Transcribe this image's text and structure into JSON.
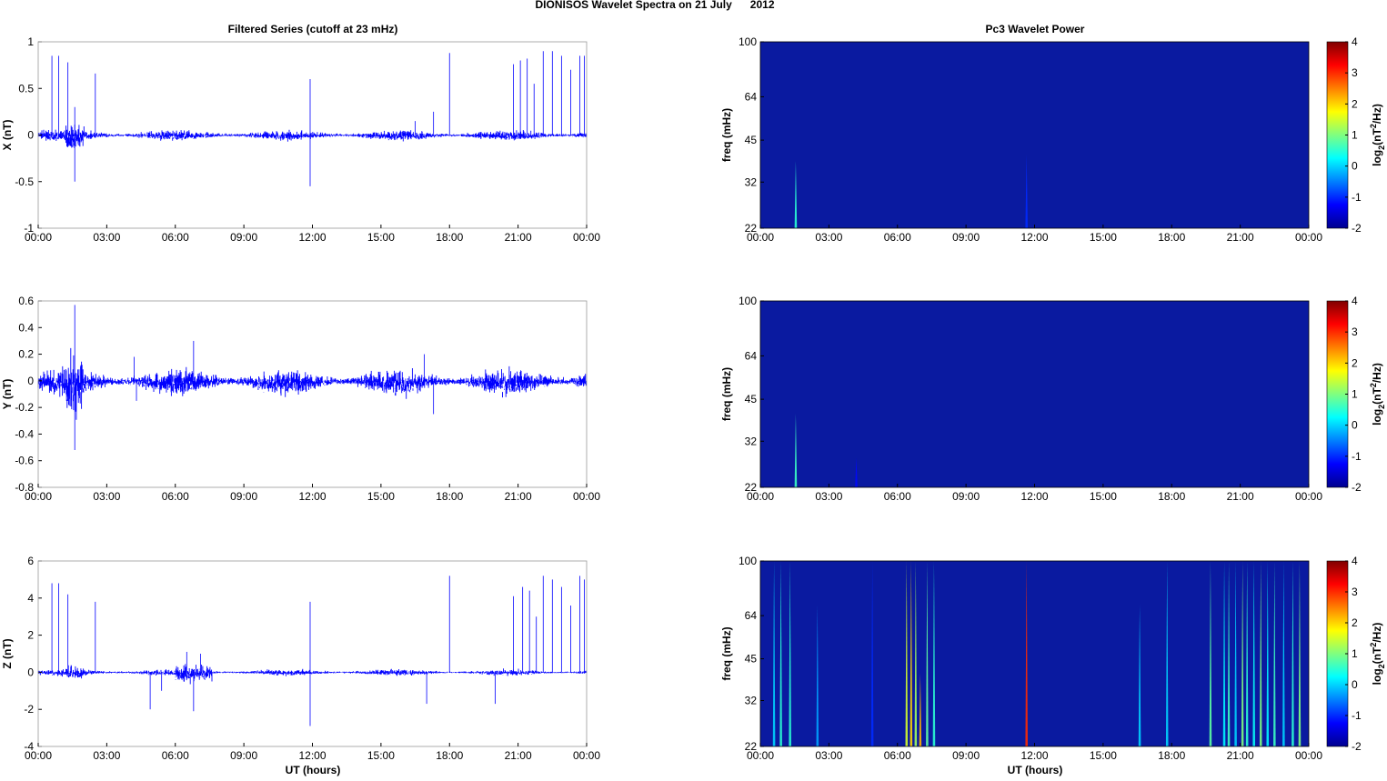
{
  "title": "DIONISOS Wavelet Spectra on 21 July      2012",
  "left_title": "Filtered Series (cutoff at 23 mHz)",
  "right_title": "Pc3 Wavelet Power",
  "xlabel": "UT (hours)",
  "x_ticks": [
    "00:00",
    "03:00",
    "06:00",
    "09:00",
    "12:00",
    "15:00",
    "18:00",
    "21:00",
    "00:00"
  ],
  "colors": {
    "series": "#0000ff",
    "background": "#0a1aa0",
    "axis": "#000000"
  },
  "chart_data": [
    {
      "type": "line",
      "ylabel": "X (nT)",
      "ylim": [
        -1,
        1
      ],
      "yticks": [
        -1,
        -0.5,
        0,
        0.5,
        1
      ],
      "xlim": [
        0,
        24
      ],
      "noise": 0.04,
      "spikes": [
        [
          0.6,
          0.85
        ],
        [
          0.9,
          0.85
        ],
        [
          1.3,
          0.78
        ],
        [
          1.6,
          0.3
        ],
        [
          1.6,
          -0.5
        ],
        [
          2.5,
          0.66
        ],
        [
          11.9,
          0.6
        ],
        [
          11.9,
          -0.55
        ],
        [
          16.5,
          0.15
        ],
        [
          18.0,
          0.88
        ],
        [
          17.3,
          0.25
        ],
        [
          20.8,
          0.76
        ],
        [
          21.1,
          0.8
        ],
        [
          21.4,
          0.82
        ],
        [
          21.7,
          0.55
        ],
        [
          22.1,
          0.9
        ],
        [
          22.5,
          0.9
        ],
        [
          22.9,
          0.85
        ],
        [
          23.3,
          0.7
        ],
        [
          23.7,
          0.85
        ],
        [
          23.9,
          0.85
        ]
      ]
    },
    {
      "type": "line",
      "ylabel": "Y (nT)",
      "ylim": [
        -0.8,
        0.6
      ],
      "yticks": [
        -0.8,
        -0.6,
        -0.4,
        -0.2,
        0,
        0.2,
        0.4,
        0.6
      ],
      "xlim": [
        0,
        24
      ],
      "noise": 0.07,
      "spikes": [
        [
          1.6,
          0.57
        ],
        [
          1.6,
          -0.52
        ],
        [
          4.2,
          0.18
        ],
        [
          4.3,
          -0.15
        ],
        [
          6.8,
          0.3
        ],
        [
          17.3,
          -0.25
        ],
        [
          16.9,
          0.2
        ]
      ]
    },
    {
      "type": "line",
      "ylabel": "Z (nT)",
      "ylim": [
        -4,
        6
      ],
      "yticks": [
        -4,
        -2,
        0,
        2,
        4,
        6
      ],
      "xlim": [
        0,
        24
      ],
      "noise": 0.12,
      "spikes": [
        [
          0.6,
          4.8
        ],
        [
          0.9,
          4.8
        ],
        [
          1.3,
          4.2
        ],
        [
          2.5,
          3.8
        ],
        [
          4.9,
          -2
        ],
        [
          5.4,
          -1.0
        ],
        [
          6.5,
          1.1
        ],
        [
          6.8,
          -2.1
        ],
        [
          7.1,
          1.0
        ],
        [
          11.9,
          3.8
        ],
        [
          11.9,
          -2.9
        ],
        [
          17.0,
          -1.7
        ],
        [
          18.0,
          5.2
        ],
        [
          20.0,
          -1.7
        ],
        [
          20.8,
          4.1
        ],
        [
          21.2,
          4.6
        ],
        [
          21.5,
          4.4
        ],
        [
          21.8,
          3.0
        ],
        [
          22.1,
          5.2
        ],
        [
          22.5,
          5.0
        ],
        [
          22.9,
          4.6
        ],
        [
          23.3,
          3.6
        ],
        [
          23.7,
          5.2
        ],
        [
          23.9,
          5.0
        ]
      ]
    },
    {
      "type": "heatmap",
      "ylabel": "freq (mHz)",
      "yticks": [
        22,
        32,
        45,
        64,
        100
      ],
      "ylim": [
        22,
        100
      ],
      "xlim": [
        0,
        24
      ],
      "clim": [
        -2,
        4
      ],
      "cbar_label": "log2(nT2/Hz)",
      "cticks": [
        -2,
        -1,
        0,
        1,
        2,
        3,
        4
      ],
      "streaks": [
        [
          1.55,
          0.5,
          38
        ],
        [
          11.65,
          -1,
          40
        ]
      ]
    },
    {
      "type": "heatmap",
      "ylabel": "freq (mHz)",
      "yticks": [
        22,
        32,
        45,
        64,
        100
      ],
      "ylim": [
        22,
        100
      ],
      "xlim": [
        0,
        24
      ],
      "clim": [
        -2,
        4
      ],
      "cbar_label": "log2(nT2/Hz)",
      "cticks": [
        -2,
        -1,
        0,
        1,
        2,
        3,
        4
      ],
      "streaks": [
        [
          1.55,
          0.6,
          40
        ],
        [
          4.2,
          -1.2,
          28
        ]
      ]
    },
    {
      "type": "heatmap",
      "ylabel": "freq (mHz)",
      "yticks": [
        22,
        32,
        45,
        64,
        100
      ],
      "ylim": [
        22,
        100
      ],
      "xlim": [
        0,
        24
      ],
      "clim": [
        -2,
        4
      ],
      "cbar_label": "log2(nT2/Hz)",
      "cticks": [
        -2,
        -1,
        0,
        1,
        2,
        3,
        4
      ],
      "streaks": [
        [
          0.6,
          0,
          100
        ],
        [
          0.9,
          0.5,
          100
        ],
        [
          1.3,
          0.5,
          100
        ],
        [
          2.5,
          -0.3,
          70
        ],
        [
          4.9,
          -1,
          100
        ],
        [
          6.4,
          1.5,
          100
        ],
        [
          6.6,
          2,
          100
        ],
        [
          6.8,
          1.2,
          100
        ],
        [
          7.0,
          2.2,
          40
        ],
        [
          7.3,
          0.8,
          100
        ],
        [
          7.6,
          0.5,
          100
        ],
        [
          11.65,
          3,
          100
        ],
        [
          16.6,
          0,
          70
        ],
        [
          17.8,
          0,
          100
        ],
        [
          19.7,
          0.8,
          100
        ],
        [
          20.3,
          0.2,
          100
        ],
        [
          20.5,
          0.6,
          100
        ],
        [
          20.8,
          0,
          100
        ],
        [
          21.1,
          1,
          100
        ],
        [
          21.3,
          0.5,
          100
        ],
        [
          21.6,
          0.3,
          100
        ],
        [
          21.9,
          1,
          100
        ],
        [
          22.2,
          0.2,
          100
        ],
        [
          22.5,
          0.6,
          100
        ],
        [
          22.9,
          0,
          100
        ],
        [
          23.3,
          0.5,
          100
        ],
        [
          23.6,
          1,
          100
        ]
      ]
    }
  ]
}
